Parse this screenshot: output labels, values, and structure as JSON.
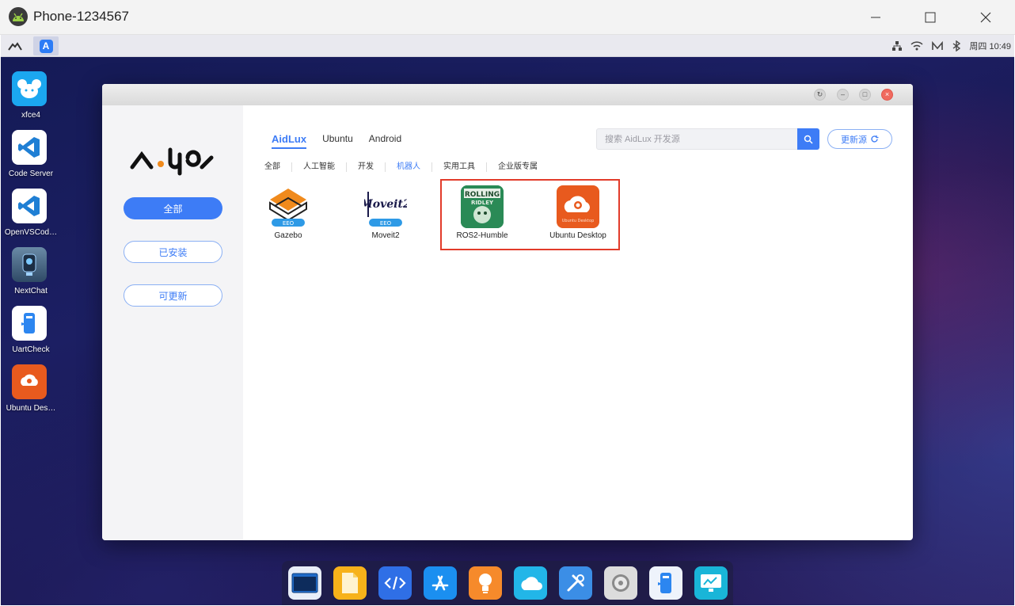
{
  "window": {
    "title": "Phone-1234567"
  },
  "topbar": {
    "clock": "周四 10:49"
  },
  "desktop": {
    "icons": [
      {
        "label": "xfce4",
        "icon": "xfce-mouse-icon",
        "color": "#1ba7f0"
      },
      {
        "label": "Code Server",
        "icon": "vscode-icon",
        "color": "#ffffff"
      },
      {
        "label": "OpenVSCod…",
        "icon": "vscode-icon",
        "color": "#ffffff"
      },
      {
        "label": "NextChat",
        "icon": "nextchat-icon",
        "color": "#4b6a86"
      },
      {
        "label": "UartCheck",
        "icon": "uartcheck-icon",
        "color": "#ffffff"
      },
      {
        "label": "Ubuntu Des…",
        "icon": "ubuntu-desktop-icon",
        "color": "#e85a1e"
      }
    ]
  },
  "store": {
    "sidebar": {
      "all": "全部",
      "installed": "已安装",
      "updatable": "可更新"
    },
    "tabs": [
      "AidLux",
      "Ubuntu",
      "Android"
    ],
    "active_tab": "AidLux",
    "categories": [
      "全部",
      "人工智能",
      "开发",
      "机器人",
      "实用工具",
      "企业版专属"
    ],
    "active_category": "机器人",
    "search": {
      "placeholder": "搜索 AidLux 开发源",
      "value": ""
    },
    "refresh_label": "更新源",
    "apps": [
      {
        "name": "Gazebo",
        "badge": "EEO"
      },
      {
        "name": "Moveit2",
        "badge": "EEO",
        "art": "Moveit2"
      },
      {
        "name": "ROS2-Humble",
        "art_top": "ROLLING",
        "art_bottom": "RIDLEY"
      },
      {
        "name": "Ubuntu Desktop",
        "art": "Ubuntu Desktop"
      }
    ]
  },
  "dock": {
    "items": [
      {
        "icon": "terminal-icon",
        "color": "#1f6bc9"
      },
      {
        "icon": "files-icon",
        "color": "#f7b21a"
      },
      {
        "icon": "code-icon",
        "color": "#2f6fe6"
      },
      {
        "icon": "app-store-icon",
        "color": "#1b8ff0"
      },
      {
        "icon": "lightbulb-icon",
        "color": "#f68a2b"
      },
      {
        "icon": "cloud-icon",
        "color": "#22b6e8"
      },
      {
        "icon": "tools-icon",
        "color": "#3b8ee6"
      },
      {
        "icon": "settings-icon",
        "color": "#dcdcdc"
      },
      {
        "icon": "uart-icon",
        "color": "#2c86f0"
      },
      {
        "icon": "monitor-icon",
        "color": "#19b5d8"
      }
    ]
  }
}
